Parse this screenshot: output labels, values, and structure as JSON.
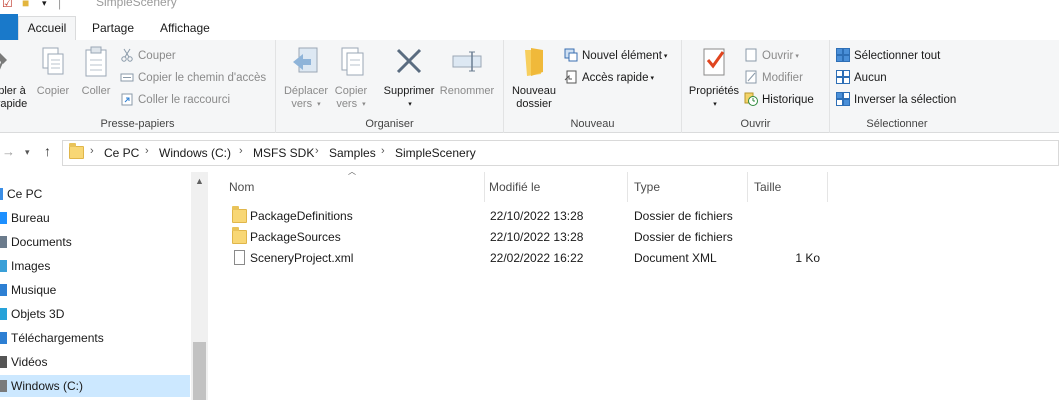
{
  "window": {
    "title": "SimpleScenery"
  },
  "ribbon_tabs": [
    {
      "label": ""
    },
    {
      "label": "Accueil"
    },
    {
      "label": "Partage"
    },
    {
      "label": "Affichage"
    }
  ],
  "clipboard": {
    "pin_label_1": "pler à",
    "pin_label_2": "rapide",
    "copy_label": "Copier",
    "paste_label": "Coller",
    "cut_label": "Couper",
    "copy_path_label": "Copier le chemin d'accès",
    "paste_shortcut_label": "Coller le raccourci",
    "group_label": "Presse-papiers"
  },
  "organize": {
    "move_label_1": "Déplacer",
    "move_label_2": "vers",
    "copy_to_label_1": "Copier",
    "copy_to_label_2": "vers",
    "delete_label": "Supprimer",
    "rename_label": "Renommer",
    "group_label": "Organiser"
  },
  "new": {
    "new_folder_label_1": "Nouveau",
    "new_folder_label_2": "dossier",
    "new_item_label": "Nouvel élément",
    "easy_access_label": "Accès rapide",
    "group_label": "Nouveau"
  },
  "open": {
    "properties_label": "Propriétés",
    "open_label": "Ouvrir",
    "edit_label": "Modifier",
    "history_label": "Historique",
    "group_label": "Ouvrir"
  },
  "select": {
    "select_all_label": "Sélectionner tout",
    "select_none_label": "Aucun",
    "invert_label": "Inverser la sélection",
    "group_label": "Sélectionner"
  },
  "breadcrumb": [
    "Ce PC",
    "Windows (C:)",
    "MSFS SDK",
    "Samples",
    "SimpleScenery"
  ],
  "nav_pane": {
    "items": [
      {
        "label": "Ce PC",
        "color": "#3a8ee6"
      },
      {
        "label": "Bureau",
        "color": "#1e90ff"
      },
      {
        "label": "Documents",
        "color": "#6b7b8c"
      },
      {
        "label": "Images",
        "color": "#3aa0d8"
      },
      {
        "label": "Musique",
        "color": "#2d7fd3"
      },
      {
        "label": "Objets 3D",
        "color": "#27a2d9"
      },
      {
        "label": "Téléchargements",
        "color": "#2d7fd3"
      },
      {
        "label": "Vidéos",
        "color": "#555555"
      },
      {
        "label": "Windows (C:)",
        "color": "#7a7a7a"
      }
    ]
  },
  "columns": {
    "name": "Nom",
    "modified": "Modifié le",
    "type": "Type",
    "size": "Taille"
  },
  "files": [
    {
      "name": "PackageDefinitions",
      "modified": "22/10/2022 13:28",
      "type": "Dossier de fichiers",
      "size": "",
      "icon": "folder-icon"
    },
    {
      "name": "PackageSources",
      "modified": "22/10/2022 13:28",
      "type": "Dossier de fichiers",
      "size": "",
      "icon": "folder-icon"
    },
    {
      "name": "SceneryProject.xml",
      "modified": "22/02/2022 16:22",
      "type": "Document XML",
      "size": "1 Ko",
      "icon": "document-icon"
    }
  ]
}
